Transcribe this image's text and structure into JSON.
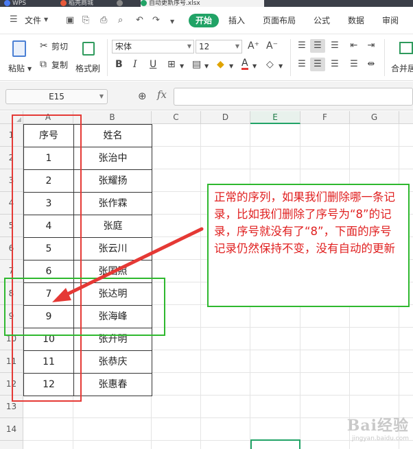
{
  "tabs": [
    {
      "label": "WPS",
      "color": "#4b7cf3"
    },
    {
      "label": "稻壳商城",
      "color": "#e8593a"
    },
    {
      "label": "",
      "color": "#888888"
    },
    {
      "label": "自动更新序号.xlsx",
      "color": "#21a366"
    }
  ],
  "menubar": {
    "file_label": "文件",
    "active_tab": "开始",
    "tabs": [
      "插入",
      "页面布局",
      "公式",
      "数据",
      "审阅"
    ]
  },
  "ribbon": {
    "paste_label": "粘贴",
    "cut_label": "剪切",
    "copy_label": "复制",
    "format_painter_label": "格式刷",
    "font_name": "宋体",
    "font_size": "12",
    "grow_label": "A⁺",
    "shrink_label": "A⁻",
    "merge_label": "合并居"
  },
  "formula_bar": {
    "name_box": "E15",
    "fx_label": "fx",
    "formula": ""
  },
  "grid": {
    "columns": [
      "A",
      "B",
      "C",
      "D",
      "E",
      "F",
      "G"
    ],
    "selected_column": "E",
    "rows": [
      "1",
      "2",
      "3",
      "4",
      "5",
      "6",
      "7",
      "8",
      "9",
      "10",
      "11",
      "12",
      "13",
      "14"
    ],
    "table": [
      [
        "序号",
        "姓名"
      ],
      [
        "1",
        "张治中"
      ],
      [
        "2",
        "张耀扬"
      ],
      [
        "3",
        "张作霖"
      ],
      [
        "4",
        "张庭"
      ],
      [
        "5",
        "张云川"
      ],
      [
        "6",
        "张国照"
      ],
      [
        "7",
        "张达明"
      ],
      [
        "9",
        "张海峰"
      ],
      [
        "10",
        "张升明"
      ],
      [
        "11",
        "张恭庆"
      ],
      [
        "12",
        "张惠春"
      ]
    ]
  },
  "annotation": {
    "text": "正常的序列，如果我们删除哪一条记录，比如我们删除了序号为“8”的记录，序号就没有了“8”，下面的序号记录仍然保持不变，没有自动的更新",
    "text_color": "#e02020",
    "box_color": "#2eb82e",
    "highlight_color": "#e53935"
  },
  "watermark": {
    "logo": "Bai经验",
    "url": "jingyan.baidu.com"
  }
}
